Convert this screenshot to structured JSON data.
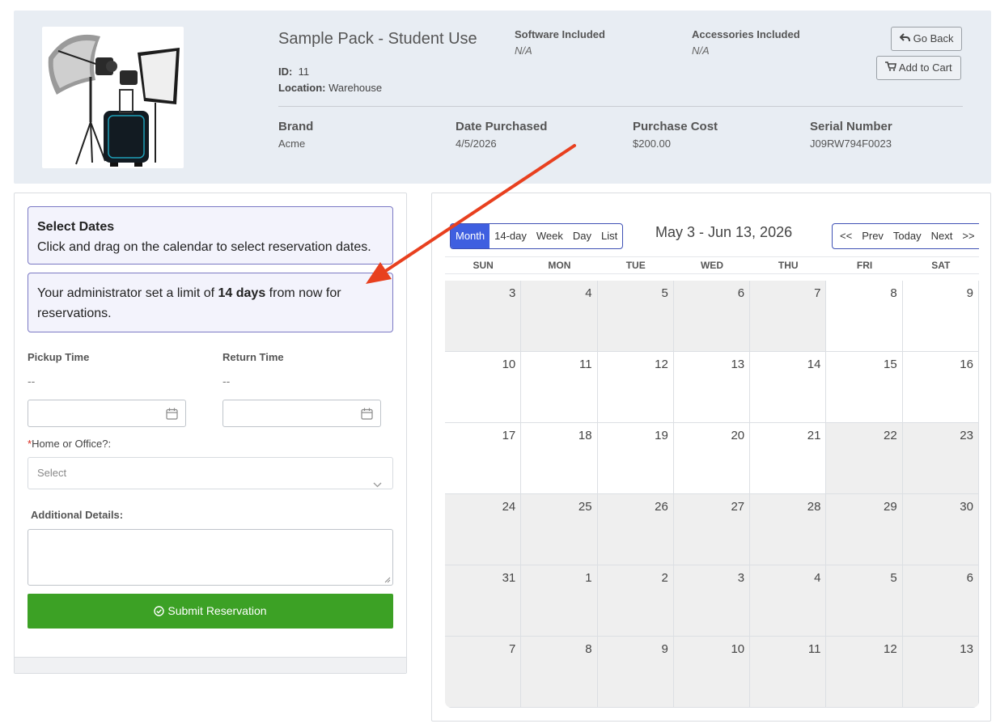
{
  "product": {
    "title": "Sample Pack - Student Use",
    "id_label": "ID:",
    "id_value": "11",
    "location_label": "Location:",
    "location_value": "Warehouse",
    "software_label": "Software Included",
    "software_value": "N/A",
    "accessories_label": "Accessories Included",
    "accessories_value": "N/A",
    "go_back_label": "Go Back",
    "add_to_cart_label": "Add to Cart",
    "brand_label": "Brand",
    "brand_value": "Acme",
    "date_purchased_label": "Date Purchased",
    "date_purchased_value": "4/5/2026",
    "purchase_cost_label": "Purchase Cost",
    "purchase_cost_value": "$200.00",
    "serial_label": "Serial Number",
    "serial_value": "J09RW794F0023"
  },
  "form": {
    "select_dates_title": "Select Dates",
    "select_dates_text": "Click and drag on the calendar to select reservation dates.",
    "limit_prefix": "Your administrator set a limit of ",
    "limit_bold": "14 days",
    "limit_suffix": " from now for reservations.",
    "pickup_label": "Pickup Time",
    "pickup_value": "--",
    "return_label": "Return Time",
    "return_value": "--",
    "home_office_required": "*",
    "home_office_label": "Home or Office?:",
    "home_office_placeholder": "Select",
    "details_label": "Additional Details:",
    "submit_label": "Submit Reservation"
  },
  "calendar": {
    "views": [
      "Month",
      "14-day",
      "Week",
      "Day",
      "List"
    ],
    "active_view": "Month",
    "range_title": "May 3 - Jun 13, 2026",
    "nav": [
      "<<",
      "Prev",
      "Today",
      "Next",
      ">>"
    ],
    "weekdays": [
      "SUN",
      "MON",
      "TUE",
      "WED",
      "THU",
      "FRI",
      "SAT"
    ],
    "weeks": [
      [
        {
          "d": "3",
          "g": true
        },
        {
          "d": "4",
          "g": true
        },
        {
          "d": "5",
          "g": true
        },
        {
          "d": "6",
          "g": true
        },
        {
          "d": "7",
          "g": true
        },
        {
          "d": "8",
          "g": false
        },
        {
          "d": "9",
          "g": false
        }
      ],
      [
        {
          "d": "10",
          "g": false
        },
        {
          "d": "11",
          "g": false
        },
        {
          "d": "12",
          "g": false
        },
        {
          "d": "13",
          "g": false
        },
        {
          "d": "14",
          "g": false
        },
        {
          "d": "15",
          "g": false
        },
        {
          "d": "16",
          "g": false
        }
      ],
      [
        {
          "d": "17",
          "g": false
        },
        {
          "d": "18",
          "g": false
        },
        {
          "d": "19",
          "g": false
        },
        {
          "d": "20",
          "g": false
        },
        {
          "d": "21",
          "g": false
        },
        {
          "d": "22",
          "g": true
        },
        {
          "d": "23",
          "g": true
        }
      ],
      [
        {
          "d": "24",
          "g": true
        },
        {
          "d": "25",
          "g": true
        },
        {
          "d": "26",
          "g": true
        },
        {
          "d": "27",
          "g": true
        },
        {
          "d": "28",
          "g": true
        },
        {
          "d": "29",
          "g": true
        },
        {
          "d": "30",
          "g": true
        }
      ],
      [
        {
          "d": "31",
          "g": true
        },
        {
          "d": "1",
          "g": true
        },
        {
          "d": "2",
          "g": true
        },
        {
          "d": "3",
          "g": true
        },
        {
          "d": "4",
          "g": true
        },
        {
          "d": "5",
          "g": true
        },
        {
          "d": "6",
          "g": true
        }
      ],
      [
        {
          "d": "7",
          "g": true
        },
        {
          "d": "8",
          "g": true
        },
        {
          "d": "9",
          "g": true
        },
        {
          "d": "10",
          "g": true
        },
        {
          "d": "11",
          "g": true
        },
        {
          "d": "12",
          "g": true
        },
        {
          "d": "13",
          "g": true
        }
      ]
    ]
  },
  "colors": {
    "accent_blue": "#3f5fe0",
    "submit_green": "#3ca125",
    "annotation_arrow": "#e8401f",
    "required_red": "#d9281c"
  }
}
